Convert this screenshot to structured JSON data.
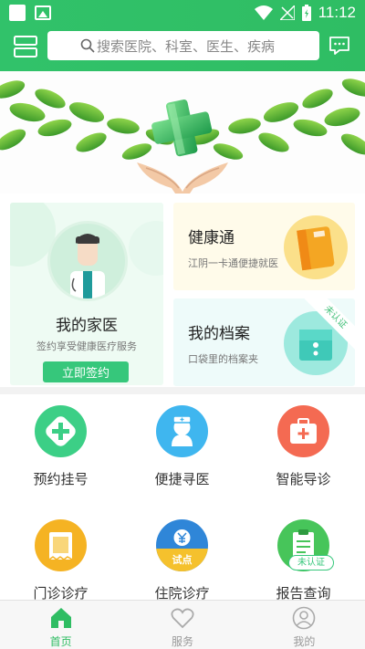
{
  "status_bar": {
    "time": "11:12"
  },
  "header": {
    "search_placeholder": "搜索医院、科室、医生、疾病"
  },
  "cards": {
    "family_doctor": {
      "title": "我的家医",
      "subtitle": "签约享受健康医疗服务",
      "button": "立即签约"
    },
    "health_pass": {
      "title": "健康通",
      "subtitle": "江阴一卡通便捷就医"
    },
    "records": {
      "title": "我的档案",
      "subtitle": "口袋里的档案夹",
      "ribbon": "未认证"
    }
  },
  "services": [
    {
      "label": "预约挂号",
      "color": "#3ccf86",
      "icon": "cross-icon"
    },
    {
      "label": "便捷寻医",
      "color": "#3fb6ef",
      "icon": "nurse-icon"
    },
    {
      "label": "智能导诊",
      "color": "#f46a52",
      "icon": "medical-kit-icon"
    },
    {
      "label": "门诊诊疗",
      "color": "#f5b323",
      "icon": "receipt-icon"
    },
    {
      "label": "住院诊疗",
      "color": "#2f86d8",
      "icon": "trial-icon",
      "tag": "试点"
    },
    {
      "label": "报告查询",
      "color": "#47c55a",
      "icon": "clipboard-icon",
      "badge": "未认证"
    }
  ],
  "tabs": [
    {
      "label": "首页",
      "active": true
    },
    {
      "label": "服务",
      "active": false
    },
    {
      "label": "我的",
      "active": false
    }
  ],
  "colors": {
    "primary": "#2fbd63"
  }
}
